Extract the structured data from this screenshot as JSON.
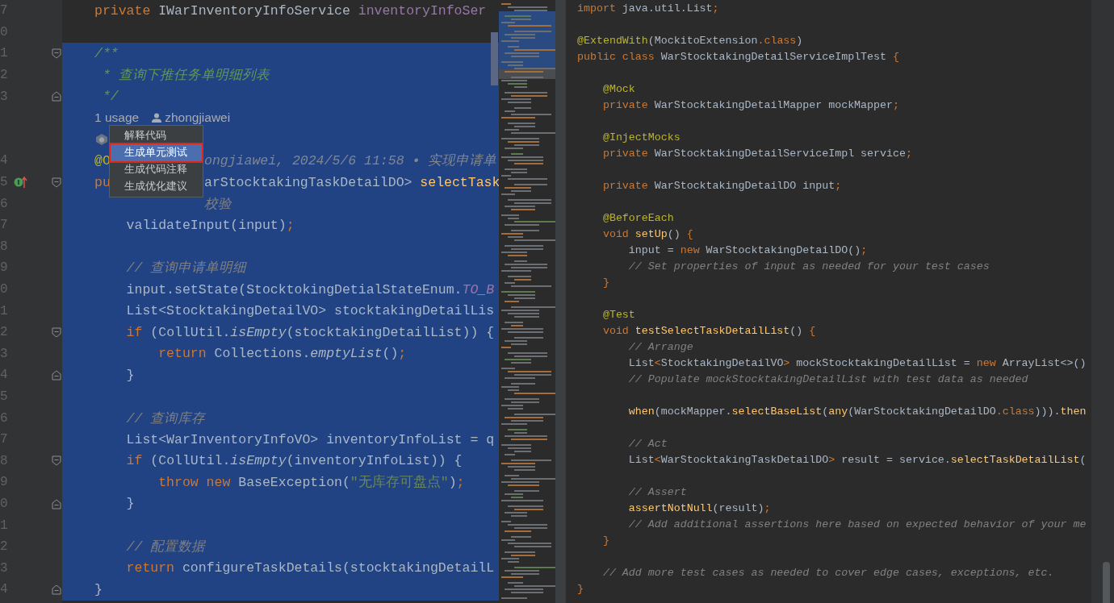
{
  "left_editor": {
    "lines": [
      {
        "kind": "code",
        "number": "7",
        "selected": false,
        "tokens": [
          {
            "kind": "keyword",
            "text": "private"
          },
          {
            "kind": "plain",
            "text": " IWarInventoryInfoService "
          },
          {
            "kind": "field",
            "text": "inventoryInfoSer"
          }
        ]
      },
      {
        "kind": "code",
        "number": "0",
        "selected": false
      },
      {
        "kind": "code",
        "number": "1",
        "selected": true,
        "fold_start": true,
        "tokens": [
          {
            "kind": "doc",
            "text": "/**"
          }
        ]
      },
      {
        "kind": "code",
        "number": "2",
        "selected": true,
        "tokens": [
          {
            "kind": "doc",
            "text": " * 查询下推任务单明细列表"
          }
        ]
      },
      {
        "kind": "code",
        "number": "3",
        "selected": true,
        "fold_end": true,
        "tokens": [
          {
            "kind": "doc",
            "text": " */"
          }
        ]
      },
      {
        "kind": "usages",
        "selected": true,
        "usages": "1 usage",
        "author": "zhongjiawei"
      },
      {
        "kind": "ai-hint",
        "selected": true
      },
      {
        "kind": "code",
        "number": "4",
        "selected": true,
        "tokens": [
          {
            "kind": "annotation",
            "text": "@O"
          }
        ],
        "tokens_after_menu": [
          {
            "kind": "blame",
            "text": "ongjiawei, 2024/5/6 11:58 • 实现申请单"
          }
        ]
      },
      {
        "kind": "code",
        "number": "5",
        "selected": true,
        "fold_start": true,
        "implements": true,
        "tokens": [
          {
            "kind": "keyword",
            "text": "pu"
          }
        ],
        "tokens_after_menu": [
          {
            "kind": "plain",
            "text": "arStocktakingTaskDetailDO> "
          },
          {
            "kind": "method",
            "text": "selectTask"
          }
        ]
      },
      {
        "kind": "code",
        "number": "6",
        "selected": true,
        "tokens_after_menu": [
          {
            "kind": "comment",
            "text": "校验"
          }
        ]
      },
      {
        "kind": "code",
        "number": "7",
        "selected": true,
        "tokens": [
          {
            "kind": "plain",
            "text": "    validateInput(input)"
          },
          {
            "kind": "keyword",
            "text": ";"
          }
        ]
      },
      {
        "kind": "code",
        "number": "8",
        "selected": true
      },
      {
        "kind": "code",
        "number": "9",
        "selected": true,
        "tokens": [
          {
            "kind": "comment",
            "text": "    // 查询申请单明细"
          }
        ]
      },
      {
        "kind": "code",
        "number": "0",
        "selected": true,
        "tokens": [
          {
            "kind": "plain",
            "text": "    input.setState(StocktokingDetialStateEnum."
          },
          {
            "kind": "constant",
            "text": "TO_B"
          }
        ]
      },
      {
        "kind": "code",
        "number": "1",
        "selected": true,
        "tokens": [
          {
            "kind": "plain",
            "text": "    List<StocktakingDetailVO> stocktakingDetailLis"
          }
        ]
      },
      {
        "kind": "code",
        "number": "2",
        "selected": true,
        "fold_start": true,
        "tokens": [
          {
            "kind": "keyword",
            "text": "    if"
          },
          {
            "kind": "plain",
            "text": " (CollUtil."
          },
          {
            "kind": "static",
            "text": "isEmpty"
          },
          {
            "kind": "plain",
            "text": "(stocktakingDetailList)) {"
          }
        ]
      },
      {
        "kind": "code",
        "number": "3",
        "selected": true,
        "tokens": [
          {
            "kind": "keyword",
            "text": "        return"
          },
          {
            "kind": "plain",
            "text": " Collections."
          },
          {
            "kind": "static",
            "text": "emptyList"
          },
          {
            "kind": "plain",
            "text": "()"
          },
          {
            "kind": "keyword",
            "text": ";"
          }
        ]
      },
      {
        "kind": "code",
        "number": "4",
        "selected": true,
        "fold_end": true,
        "tokens": [
          {
            "kind": "plain",
            "text": "    }"
          }
        ]
      },
      {
        "kind": "code",
        "number": "5",
        "selected": true
      },
      {
        "kind": "code",
        "number": "6",
        "selected": true,
        "tokens": [
          {
            "kind": "comment",
            "text": "    // 查询库存"
          }
        ]
      },
      {
        "kind": "code",
        "number": "7",
        "selected": true,
        "tokens": [
          {
            "kind": "plain",
            "text": "    List<WarInventoryInfoVO> inventoryInfoList = q"
          }
        ]
      },
      {
        "kind": "code",
        "number": "8",
        "selected": true,
        "fold_start": true,
        "tokens": [
          {
            "kind": "keyword",
            "text": "    if"
          },
          {
            "kind": "plain",
            "text": " (CollUtil."
          },
          {
            "kind": "static",
            "text": "isEmpty"
          },
          {
            "kind": "plain",
            "text": "(inventoryInfoList)) {"
          }
        ]
      },
      {
        "kind": "code",
        "number": "9",
        "selected": true,
        "tokens": [
          {
            "kind": "keyword",
            "text": "        throw new"
          },
          {
            "kind": "plain",
            "text": " BaseException("
          },
          {
            "kind": "string",
            "text": "\"无库存可盘点\""
          },
          {
            "kind": "plain",
            "text": ")"
          },
          {
            "kind": "keyword",
            "text": ";"
          }
        ]
      },
      {
        "kind": "code",
        "number": "0",
        "selected": true,
        "fold_end": true,
        "tokens": [
          {
            "kind": "plain",
            "text": "    }"
          }
        ]
      },
      {
        "kind": "code",
        "number": "1",
        "selected": true
      },
      {
        "kind": "code",
        "number": "2",
        "selected": true,
        "tokens": [
          {
            "kind": "comment",
            "text": "    // 配置数据"
          }
        ]
      },
      {
        "kind": "code",
        "number": "3",
        "selected": true,
        "tokens": [
          {
            "kind": "keyword",
            "text": "    return"
          },
          {
            "kind": "plain",
            "text": " configureTaskDetails(stocktakingDetailL"
          }
        ]
      },
      {
        "kind": "code",
        "number": "4",
        "selected": true,
        "fold_end": true,
        "tokens": [
          {
            "kind": "plain",
            "text": "}"
          }
        ]
      }
    ]
  },
  "context_menu": {
    "items": [
      {
        "label": "解释代码",
        "selected": false
      },
      {
        "label": "生成单元测试",
        "selected": true
      },
      {
        "label": "生成代码注释",
        "selected": false
      },
      {
        "label": "生成优化建议",
        "selected": false
      }
    ]
  },
  "right_editor": {
    "lines": [
      {
        "kind": "code",
        "tokens": [
          {
            "kind": "keyword",
            "text": "import"
          },
          {
            "kind": "plain",
            "text": " java.util.List"
          },
          {
            "kind": "keyword",
            "text": ";"
          }
        ]
      },
      {
        "kind": "blank"
      },
      {
        "kind": "code",
        "tokens": [
          {
            "kind": "annotation",
            "text": "@ExtendWith"
          },
          {
            "kind": "plain",
            "text": "(MockitoExtension"
          },
          {
            "kind": "keyword",
            "text": ".class"
          },
          {
            "kind": "plain",
            "text": ")"
          }
        ]
      },
      {
        "kind": "code",
        "tokens": [
          {
            "kind": "keyword",
            "text": "public class"
          },
          {
            "kind": "plain",
            "text": " WarStocktakingDetailServiceImplTest "
          },
          {
            "kind": "keyword",
            "text": "{"
          }
        ]
      },
      {
        "kind": "blank"
      },
      {
        "kind": "code",
        "tokens": [
          {
            "kind": "annotation",
            "text": "    @Mock"
          }
        ]
      },
      {
        "kind": "code",
        "tokens": [
          {
            "kind": "keyword",
            "text": "    private"
          },
          {
            "kind": "plain",
            "text": " WarStocktakingDetailMapper mockMapper"
          },
          {
            "kind": "keyword",
            "text": ";"
          }
        ]
      },
      {
        "kind": "blank"
      },
      {
        "kind": "code",
        "tokens": [
          {
            "kind": "annotation",
            "text": "    @InjectMocks"
          }
        ]
      },
      {
        "kind": "code",
        "tokens": [
          {
            "kind": "keyword",
            "text": "    private"
          },
          {
            "kind": "plain",
            "text": " WarStocktakingDetailServiceImpl service"
          },
          {
            "kind": "keyword",
            "text": ";"
          }
        ]
      },
      {
        "kind": "blank"
      },
      {
        "kind": "code",
        "tokens": [
          {
            "kind": "keyword",
            "text": "    private"
          },
          {
            "kind": "plain",
            "text": " WarStocktakingDetailDO input"
          },
          {
            "kind": "keyword",
            "text": ";"
          }
        ]
      },
      {
        "kind": "blank"
      },
      {
        "kind": "code",
        "tokens": [
          {
            "kind": "annotation",
            "text": "    @BeforeEach"
          }
        ]
      },
      {
        "kind": "code",
        "tokens": [
          {
            "kind": "keyword",
            "text": "    void"
          },
          {
            "kind": "method",
            "text": " setUp"
          },
          {
            "kind": "plain",
            "text": "() "
          },
          {
            "kind": "keyword",
            "text": "{"
          }
        ]
      },
      {
        "kind": "code",
        "tokens": [
          {
            "kind": "plain",
            "text": "        input = "
          },
          {
            "kind": "keyword",
            "text": "new"
          },
          {
            "kind": "plain",
            "text": " WarStocktakingDetailDO()"
          },
          {
            "kind": "keyword",
            "text": ";"
          }
        ]
      },
      {
        "kind": "code",
        "tokens": [
          {
            "kind": "comment",
            "text": "        // Set properties of input as needed for your test cases"
          }
        ]
      },
      {
        "kind": "code",
        "tokens": [
          {
            "kind": "keyword",
            "text": "    }"
          }
        ]
      },
      {
        "kind": "blank"
      },
      {
        "kind": "code",
        "tokens": [
          {
            "kind": "annotation",
            "text": "    @Test"
          }
        ]
      },
      {
        "kind": "code",
        "tokens": [
          {
            "kind": "keyword",
            "text": "    void"
          },
          {
            "kind": "method",
            "text": " testSelectTaskDetailList"
          },
          {
            "kind": "plain",
            "text": "() "
          },
          {
            "kind": "keyword",
            "text": "{"
          }
        ]
      },
      {
        "kind": "code",
        "tokens": [
          {
            "kind": "comment",
            "text": "        // Arrange"
          }
        ]
      },
      {
        "kind": "code",
        "tokens": [
          {
            "kind": "plain",
            "text": "        List"
          },
          {
            "kind": "keyword",
            "text": "<"
          },
          {
            "kind": "plain",
            "text": "StocktakingDetailVO"
          },
          {
            "kind": "keyword",
            "text": ">"
          },
          {
            "kind": "plain",
            "text": " mockStocktakingDetailList = "
          },
          {
            "kind": "keyword",
            "text": "new"
          },
          {
            "kind": "plain",
            "text": " ArrayList<>()"
          }
        ]
      },
      {
        "kind": "code",
        "tokens": [
          {
            "kind": "comment",
            "text": "        // Populate mockStocktakingDetailList with test data as needed"
          }
        ]
      },
      {
        "kind": "blank"
      },
      {
        "kind": "code",
        "tokens": [
          {
            "kind": "method",
            "text": "        when"
          },
          {
            "kind": "plain",
            "text": "(mockMapper."
          },
          {
            "kind": "method",
            "text": "selectBaseList"
          },
          {
            "kind": "plain",
            "text": "("
          },
          {
            "kind": "method",
            "text": "any"
          },
          {
            "kind": "plain",
            "text": "(WarStocktakingDetailDO"
          },
          {
            "kind": "keyword",
            "text": ".class"
          },
          {
            "kind": "plain",
            "text": ")))."
          },
          {
            "kind": "method",
            "text": "then"
          }
        ]
      },
      {
        "kind": "blank"
      },
      {
        "kind": "code",
        "tokens": [
          {
            "kind": "comment",
            "text": "        // Act"
          }
        ]
      },
      {
        "kind": "code",
        "tokens": [
          {
            "kind": "plain",
            "text": "        List"
          },
          {
            "kind": "keyword",
            "text": "<"
          },
          {
            "kind": "plain",
            "text": "WarStocktakingTaskDetailDO"
          },
          {
            "kind": "keyword",
            "text": ">"
          },
          {
            "kind": "plain",
            "text": " result = service."
          },
          {
            "kind": "method",
            "text": "selectTaskDetailList"
          },
          {
            "kind": "plain",
            "text": "("
          }
        ]
      },
      {
        "kind": "blank"
      },
      {
        "kind": "code",
        "tokens": [
          {
            "kind": "comment",
            "text": "        // Assert"
          }
        ]
      },
      {
        "kind": "code",
        "tokens": [
          {
            "kind": "method",
            "text": "        assertNotNull"
          },
          {
            "kind": "plain",
            "text": "(result)"
          },
          {
            "kind": "keyword",
            "text": ";"
          }
        ]
      },
      {
        "kind": "code",
        "tokens": [
          {
            "kind": "comment",
            "text": "        // Add additional assertions here based on expected behavior of your me"
          }
        ]
      },
      {
        "kind": "code",
        "tokens": [
          {
            "kind": "keyword",
            "text": "    }"
          }
        ]
      },
      {
        "kind": "blank"
      },
      {
        "kind": "code",
        "tokens": [
          {
            "kind": "comment",
            "text": "    // Add more test cases as needed to cover edge cases, exceptions, etc."
          }
        ]
      },
      {
        "kind": "code",
        "tokens": [
          {
            "kind": "keyword",
            "text": "}"
          }
        ]
      }
    ]
  }
}
